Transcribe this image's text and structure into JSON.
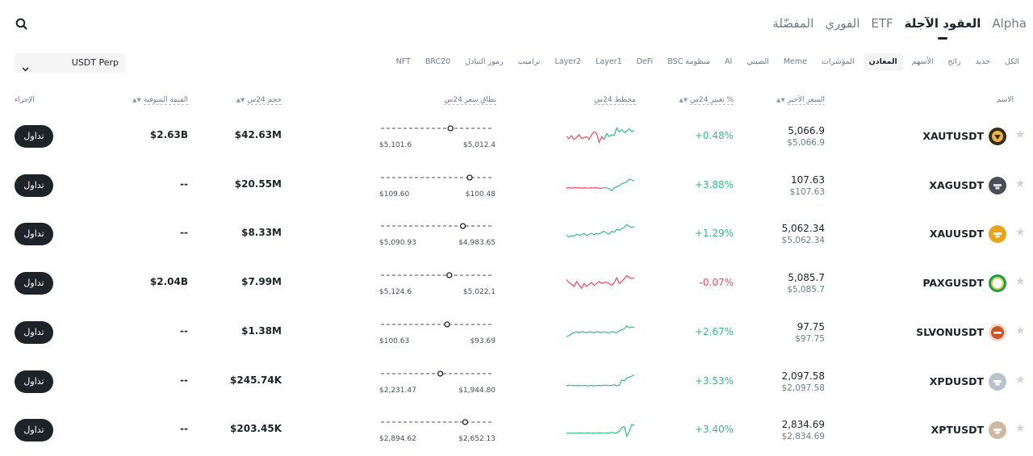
{
  "main_tabs": [
    {
      "label": "المفضّلة",
      "active": false
    },
    {
      "label": "الفوري",
      "active": false
    },
    {
      "label": "ETF",
      "active": false
    },
    {
      "label": "العقود الآجلة",
      "active": true
    },
    {
      "label": "Alpha",
      "active": false
    }
  ],
  "search_icon": "search-icon",
  "contract_select": {
    "value": "USDT Perp",
    "icon": "chevron-down-icon"
  },
  "categories": [
    {
      "label": "الكل",
      "active": false
    },
    {
      "label": "جديد",
      "active": false
    },
    {
      "label": "رائج",
      "active": false
    },
    {
      "label": "الأسهم",
      "active": false
    },
    {
      "label": "المعادن",
      "active": true
    },
    {
      "label": "المؤشرات",
      "active": false
    },
    {
      "label": "Meme",
      "active": false
    },
    {
      "label": "الصيني",
      "active": false
    },
    {
      "label": "AI",
      "active": false
    },
    {
      "label": "منظومة BSC",
      "active": false
    },
    {
      "label": "DeFi",
      "active": false
    },
    {
      "label": "Layer1",
      "active": false
    },
    {
      "label": "Layer2",
      "active": false
    },
    {
      "label": "تراميب",
      "active": false
    },
    {
      "label": "رموز التبادل",
      "active": false
    },
    {
      "label": "BRC20",
      "active": false
    },
    {
      "label": "NFT",
      "active": false
    }
  ],
  "columns": {
    "name": "الاسم",
    "last_price": "السعر الأخير",
    "change": "تغيير 24س %",
    "chart": "مخطط 24س",
    "range": "نطاق سعر 24س",
    "volume": "حجم 24س",
    "market_cap": "القيمة السوقية",
    "action": "الإجراء"
  },
  "trade_label": "تداول",
  "colors": {
    "up": "#2ebd85",
    "down": "#f6465d",
    "text": "#1e2329",
    "muted": "#707a8a",
    "button": "#1e2329"
  },
  "rows": [
    {
      "symbol": "XAUTUSDT",
      "icon": "tether-gold-icon",
      "price": "5,066.9",
      "price_usd": "$5,066.9",
      "change": "+0.48%",
      "trend": "up",
      "range_low": "$5,012.4",
      "range_high": "$5,101.6",
      "range_position": 0.63,
      "volume": "$42.63M",
      "market_cap": "$2.63B",
      "spark": [
        0.45,
        0.35,
        0.5,
        0.3,
        0.4,
        0.55,
        0.35,
        0.4,
        0.45,
        0.3,
        0.55,
        0.7,
        0.6,
        0.15,
        0.45,
        0.3,
        0.6,
        0.45,
        0.55,
        0.5,
        0.9,
        0.7,
        0.8,
        0.65,
        0.72,
        0.85,
        0.7,
        0.75
      ]
    },
    {
      "symbol": "XAGUSDT",
      "icon": "silver-icon",
      "price": "107.63",
      "price_usd": "$107.63",
      "change": "+3.88%",
      "trend": "up",
      "range_low": "$100.48",
      "range_high": "$109.60",
      "range_position": 0.8,
      "volume": "$20.55M",
      "market_cap": "--",
      "spark": [
        0.35,
        0.35,
        0.33,
        0.36,
        0.34,
        0.35,
        0.33,
        0.35,
        0.34,
        0.33,
        0.35,
        0.34,
        0.35,
        0.33,
        0.32,
        0.35,
        0.34,
        0.3,
        0.2,
        0.35,
        0.4,
        0.45,
        0.55,
        0.6,
        0.65,
        0.8,
        0.75,
        0.7
      ]
    },
    {
      "symbol": "XAUUSDT",
      "icon": "gold-icon",
      "price": "5,062.34",
      "price_usd": "$5,062.34",
      "change": "+1.29%",
      "trend": "up",
      "range_low": "$4,983.65",
      "range_high": "$5,090.93",
      "range_position": 0.74,
      "volume": "$8.33M",
      "market_cap": "--",
      "spark": [
        0.4,
        0.3,
        0.38,
        0.35,
        0.45,
        0.4,
        0.42,
        0.5,
        0.38,
        0.45,
        0.5,
        0.42,
        0.5,
        0.45,
        0.55,
        0.6,
        0.5,
        0.45,
        0.6,
        0.55,
        0.7,
        0.65,
        0.75,
        0.8,
        0.95,
        0.85,
        0.8,
        0.85
      ]
    },
    {
      "symbol": "PAXGUSDT",
      "icon": "pax-gold-icon",
      "price": "5,085.7",
      "price_usd": "$5,085.7",
      "change": "-0.07%",
      "trend": "down",
      "range_low": "$5,022.1",
      "range_high": "$5,124.6",
      "range_position": 0.62,
      "volume": "$7.99M",
      "market_cap": "$2.04B",
      "spark": [
        0.65,
        0.5,
        0.4,
        0.3,
        0.55,
        0.35,
        0.2,
        0.45,
        0.3,
        0.4,
        0.5,
        0.35,
        0.45,
        0.55,
        0.45,
        0.5,
        0.5,
        0.45,
        0.35,
        0.5,
        0.75,
        0.45,
        0.55,
        0.7,
        0.85,
        0.75,
        0.7,
        0.75
      ]
    },
    {
      "symbol": "SLVONUSDT",
      "icon": "slvon-icon",
      "price": "97.75",
      "price_usd": "$97.75",
      "change": "+2.67%",
      "trend": "up",
      "range_low": "$93.69",
      "range_high": "$100.63",
      "range_position": 0.6,
      "volume": "$1.38M",
      "market_cap": "--",
      "spark": [
        0.25,
        0.3,
        0.4,
        0.45,
        0.5,
        0.45,
        0.5,
        0.48,
        0.45,
        0.5,
        0.47,
        0.45,
        0.5,
        0.48,
        0.45,
        0.5,
        0.45,
        0.45,
        0.5,
        0.48,
        0.45,
        0.55,
        0.6,
        0.65,
        0.8,
        0.7,
        0.75,
        0.72
      ]
    },
    {
      "symbol": "XPDUSDT",
      "icon": "palladium-icon",
      "price": "2,097.58",
      "price_usd": "$2,097.58",
      "change": "+3.53%",
      "trend": "up",
      "range_low": "$1,944.80",
      "range_high": "$2,231.47",
      "range_position": 0.54,
      "volume": "$245.74K",
      "market_cap": "--",
      "spark": [
        0.25,
        0.28,
        0.26,
        0.27,
        0.25,
        0.27,
        0.26,
        0.27,
        0.25,
        0.26,
        0.27,
        0.25,
        0.26,
        0.27,
        0.26,
        0.28,
        0.27,
        0.26,
        0.27,
        0.3,
        0.25,
        0.28,
        0.55,
        0.5,
        0.65,
        0.7,
        0.75,
        0.8
      ]
    },
    {
      "symbol": "XPTUSDT",
      "icon": "platinum-icon",
      "price": "2,834.69",
      "price_usd": "$2,834.69",
      "change": "+3.40%",
      "trend": "up",
      "range_low": "$2,652.13",
      "range_high": "$2,894.62",
      "range_position": 0.76,
      "volume": "$203.45K",
      "market_cap": "--",
      "spark": [
        0.3,
        0.32,
        0.3,
        0.31,
        0.3,
        0.32,
        0.31,
        0.3,
        0.32,
        0.31,
        0.3,
        0.31,
        0.3,
        0.33,
        0.31,
        0.3,
        0.32,
        0.31,
        0.35,
        0.3,
        0.32,
        0.4,
        0.6,
        0.65,
        0.15,
        0.4,
        0.75,
        0.7
      ]
    }
  ]
}
